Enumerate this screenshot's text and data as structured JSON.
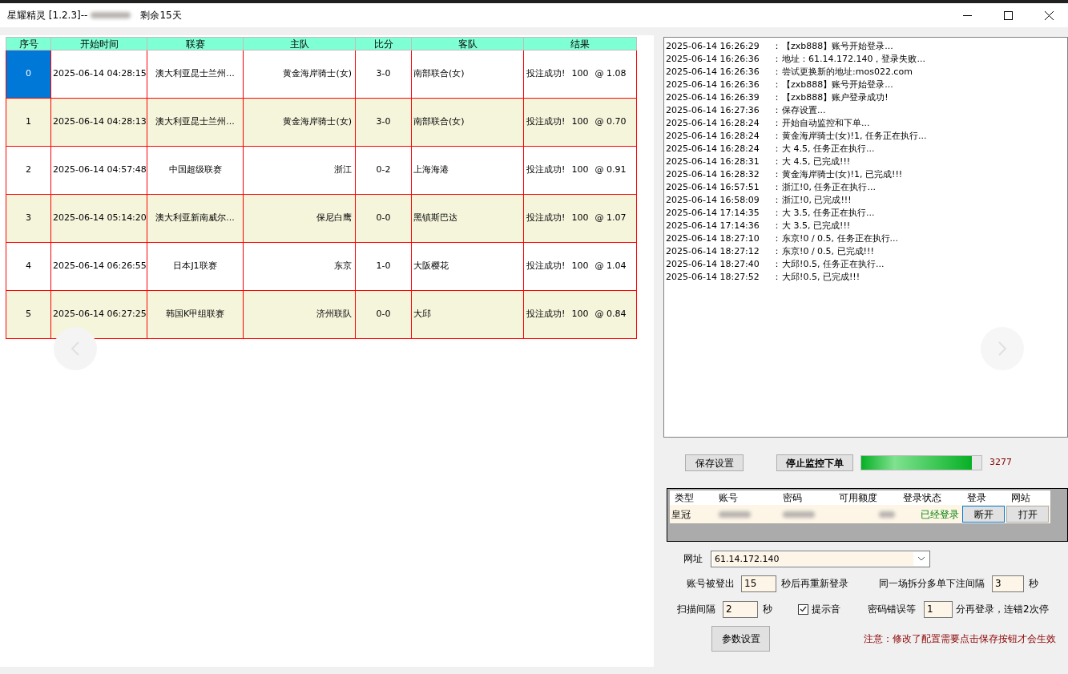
{
  "window": {
    "title": "星耀精灵 [1.2.3]--",
    "title_suffix": "剩余15天"
  },
  "table": {
    "columns": [
      "序号",
      "开始时间",
      "联赛",
      "主队",
      "比分",
      "客队",
      "结果"
    ],
    "rows": [
      {
        "index": "0",
        "selected": true,
        "start_time": "2025-06-14 04:28:15",
        "league": "澳大利亚昆士兰州...",
        "home": "黄金海岸骑士(女)",
        "score": "3-0",
        "away": "南部联合(女)",
        "result": "投注成功!",
        "stake": "100",
        "odds": "@ 1.08"
      },
      {
        "index": "1",
        "selected": false,
        "start_time": "2025-06-14 04:28:13",
        "league": "澳大利亚昆士兰州...",
        "home": "黄金海岸骑士(女)",
        "score": "3-0",
        "away": "南部联合(女)",
        "result": "投注成功!",
        "stake": "100",
        "odds": "@ 0.70"
      },
      {
        "index": "2",
        "selected": false,
        "start_time": "2025-06-14 04:57:48",
        "league": "中国超级联赛",
        "home": "浙江",
        "score": "0-2",
        "away": "上海海港",
        "result": "投注成功!",
        "stake": "100",
        "odds": "@ 0.91"
      },
      {
        "index": "3",
        "selected": false,
        "start_time": "2025-06-14 05:14:20",
        "league": "澳大利亚新南威尔...",
        "home": "保尼白鹰",
        "score": "0-0",
        "away": "黑镇斯巴达",
        "result": "投注成功!",
        "stake": "100",
        "odds": "@ 1.07"
      },
      {
        "index": "4",
        "selected": false,
        "start_time": "2025-06-14 06:26:55",
        "league": "日本J1联赛",
        "home": "东京",
        "score": "1-0",
        "away": "大阪樱花",
        "result": "投注成功!",
        "stake": "100",
        "odds": "@ 1.04"
      },
      {
        "index": "5",
        "selected": false,
        "start_time": "2025-06-14 06:27:25",
        "league": "韩国K甲组联赛",
        "home": "济州联队",
        "score": "0-0",
        "away": "大邱",
        "result": "投注成功!",
        "stake": "100",
        "odds": "@ 0.84"
      }
    ]
  },
  "log": [
    {
      "time": "2025-06-14 16:26:29",
      "sep": "：",
      "message": "【zxb888】账号开始登录..."
    },
    {
      "time": "2025-06-14 16:26:36",
      "sep": "：",
      "message": "地址：61.14.172.140，登录失败..."
    },
    {
      "time": "2025-06-14 16:26:36",
      "sep": "：",
      "message": "尝试更换新的地址:mos022.com"
    },
    {
      "time": "2025-06-14 16:26:36",
      "sep": "：",
      "message": "【zxb888】账号开始登录..."
    },
    {
      "time": "2025-06-14 16:26:39",
      "sep": "：",
      "message": "【zxb888】账户登录成功!"
    },
    {
      "time": "2025-06-14 16:27:36",
      "sep": "：",
      "message": "保存设置..."
    },
    {
      "time": "2025-06-14 16:28:24",
      "sep": "：",
      "message": "开始自动监控和下单..."
    },
    {
      "time": "2025-06-14 16:28:24",
      "sep": "：",
      "message": "黄金海岸骑士(女)!1, 任务正在执行..."
    },
    {
      "time": "2025-06-14 16:28:24",
      "sep": "：",
      "message": "大 4.5, 任务正在执行..."
    },
    {
      "time": "2025-06-14 16:28:31",
      "sep": "：",
      "message": "大 4.5, 已完成!!!"
    },
    {
      "time": "2025-06-14 16:28:32",
      "sep": "：",
      "message": "黄金海岸骑士(女)!1, 已完成!!!"
    },
    {
      "time": "2025-06-14 16:57:51",
      "sep": "：",
      "message": "浙江!0, 任务正在执行..."
    },
    {
      "time": "2025-06-14 16:58:09",
      "sep": "：",
      "message": "浙江!0, 已完成!!!"
    },
    {
      "time": "2025-06-14 17:14:35",
      "sep": "：",
      "message": "大 3.5, 任务正在执行..."
    },
    {
      "time": "2025-06-14 17:14:36",
      "sep": "：",
      "message": "大 3.5, 已完成!!!"
    },
    {
      "time": "2025-06-14 18:27:10",
      "sep": "：",
      "message": "东京!0 / 0.5, 任务正在执行..."
    },
    {
      "time": "2025-06-14 18:27:12",
      "sep": "：",
      "message": "东京!0 / 0.5, 已完成!!!"
    },
    {
      "time": "2025-06-14 18:27:40",
      "sep": "：",
      "message": "大邱!0.5, 任务正在执行..."
    },
    {
      "time": "2025-06-14 18:27:52",
      "sep": "：",
      "message": "大邱!0.5, 已完成!!!"
    }
  ],
  "actions": {
    "save": "保存设置",
    "stop": "停止监控下单",
    "progress": {
      "level": 0.92
    },
    "count": "3277"
  },
  "accounts": {
    "columns": [
      "类型",
      "账号",
      "密码",
      "可用额度",
      "登录状态",
      "登录",
      "网站"
    ],
    "rows": [
      {
        "type": "皇冠",
        "status": "已经登录",
        "login_button": "断开",
        "site_button": "打开"
      }
    ]
  },
  "settings": {
    "url_label": "网址",
    "url": "61.14.172.140",
    "relogin_label": "账号被登出",
    "relogin_value": "15",
    "relogin_suffix": "秒后再重新登录",
    "split_label": "同一场拆分多单下注间隔",
    "split_value": "3",
    "split_suffix": "秒",
    "scan_label": "扫描间隔",
    "scan_value": "2",
    "scan_suffix": "秒",
    "sound": {
      "label": "提示音",
      "checked": true
    },
    "pwd_label": "密码错误等",
    "pwd_value": "1",
    "pwd_suffix": "分再登录，连错2次停",
    "params_button": "参数设置",
    "notice": "注意：修改了配置需要点击保存按钮才会生效"
  }
}
